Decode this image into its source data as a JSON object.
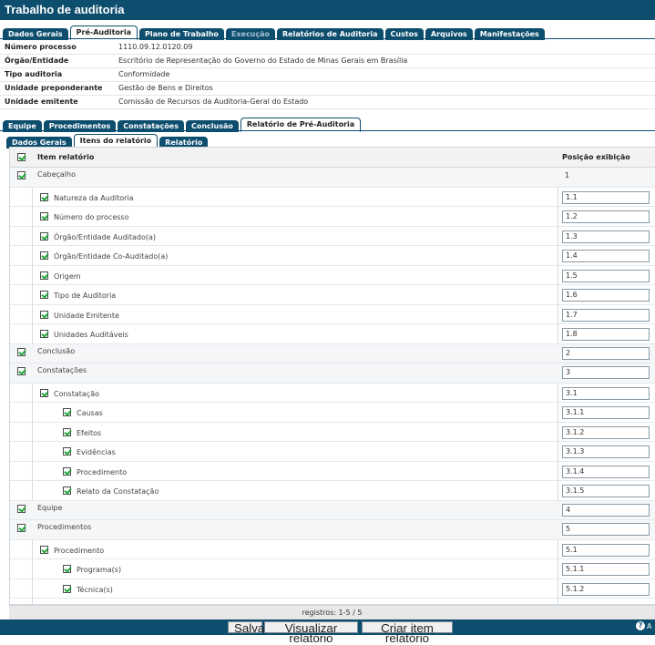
{
  "window": {
    "title": "Trabalho de auditoria"
  },
  "top_tabs": [
    {
      "label": "Dados Gerais",
      "state": "normal"
    },
    {
      "label": "Pré-Auditoria",
      "state": "active"
    },
    {
      "label": "Plano de Trabalho",
      "state": "normal"
    },
    {
      "label": "Execução",
      "state": "disabled"
    },
    {
      "label": "Relatórios de Auditoria",
      "state": "normal"
    },
    {
      "label": "Custos",
      "state": "normal"
    },
    {
      "label": "Arquivos",
      "state": "normal"
    },
    {
      "label": "Manifestações",
      "state": "normal"
    }
  ],
  "info": [
    {
      "label": "Número processo",
      "value": "1110.09.12.0120.09"
    },
    {
      "label": "Órgão/Entidade",
      "value": "Escritório de Representação do Governo do Estado de Minas Gerais em Brasília"
    },
    {
      "label": "Tipo auditoria",
      "value": "Conformidade"
    },
    {
      "label": "Unidade preponderante",
      "value": "Gestão de Bens e Direitos"
    },
    {
      "label": "Unidade emitente",
      "value": "Comissão de Recursos da Auditoria-Geral do Estado"
    }
  ],
  "sub_tabs": [
    {
      "label": "Equipe",
      "state": "normal"
    },
    {
      "label": "Procedimentos",
      "state": "normal"
    },
    {
      "label": "Constatações",
      "state": "normal"
    },
    {
      "label": "Conclusão",
      "state": "normal"
    },
    {
      "label": "Relatório de Pré-Auditoria",
      "state": "active"
    }
  ],
  "third_tabs": [
    {
      "label": "Dados Gerais",
      "state": "normal"
    },
    {
      "label": "Itens do relatório",
      "state": "active"
    },
    {
      "label": "Relatório",
      "state": "normal"
    }
  ],
  "grid": {
    "col_item": "Item relatório",
    "col_pos": "Posição exibição",
    "rows": [
      {
        "level": 0,
        "label": "Cabeçalho",
        "pos": "1",
        "editable": false
      },
      {
        "level": 1,
        "label": " Natureza da Auditoria",
        "pos": "1.1",
        "editable": true
      },
      {
        "level": 1,
        "label": "Número do processo",
        "pos": "1.2",
        "editable": true
      },
      {
        "level": 1,
        "label": "Órgão/Entidade Auditado(a)",
        "pos": "1.3",
        "editable": true
      },
      {
        "level": 1,
        "label": "Órgão/Entidade Co-Auditado(a)",
        "pos": "1.4",
        "editable": true
      },
      {
        "level": 1,
        "label": "Origem",
        "pos": "1.5",
        "editable": true
      },
      {
        "level": 1,
        "label": "Tipo de Auditoria",
        "pos": "1.6",
        "editable": true
      },
      {
        "level": 1,
        "label": "Unidade Emitente",
        "pos": "1.7",
        "editable": true
      },
      {
        "level": 1,
        "label": "Unidades Auditáveis",
        "pos": "1.8",
        "editable": true
      },
      {
        "level": 0,
        "label": "Conclusão",
        "pos": "2",
        "editable": true
      },
      {
        "level": 0,
        "label": "Constatações",
        "pos": "3",
        "editable": true
      },
      {
        "level": 1,
        "label": "Constatação",
        "pos": "3.1",
        "editable": true
      },
      {
        "level": 2,
        "label": " Causas",
        "pos": "3.1.1",
        "editable": true
      },
      {
        "level": 2,
        "label": "Efeitos",
        "pos": "3.1.2",
        "editable": true
      },
      {
        "level": 2,
        "label": "Evidências",
        "pos": "3.1.3",
        "editable": true
      },
      {
        "level": 2,
        "label": "Procedimento",
        "pos": "3.1.4",
        "editable": true
      },
      {
        "level": 2,
        "label": "Relato da Constatação",
        "pos": "3.1.5",
        "editable": true
      },
      {
        "level": 0,
        "label": "Equipe",
        "pos": "4",
        "editable": true
      },
      {
        "level": 0,
        "label": "Procedimentos",
        "pos": "5",
        "editable": true
      },
      {
        "level": 1,
        "label": "Procedimento",
        "pos": "5.1",
        "editable": true
      },
      {
        "level": 2,
        "label": " Programa(s)",
        "pos": "5.1.1",
        "editable": true
      },
      {
        "level": 2,
        "label": "Técnica(s)",
        "pos": "5.1.2",
        "editable": true
      }
    ]
  },
  "footer": {
    "records": "registros: 1-5 / 5"
  },
  "buttons": {
    "save": "Salvar",
    "view": "Visualizar relatório",
    "create": "Criar item relatório"
  },
  "help": {
    "label": "A"
  },
  "colors": {
    "primary": "#0d4d6e",
    "check": "#21a63a"
  }
}
